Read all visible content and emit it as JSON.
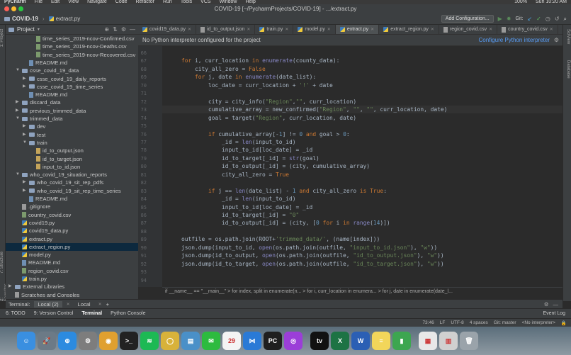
{
  "menubar": {
    "items": [
      "PyCharm",
      "File",
      "Edit",
      "View",
      "Navigate",
      "Code",
      "Refactor",
      "Run",
      "Tools",
      "VCS",
      "Window",
      "Help"
    ],
    "clock": "Sun 10:20 AM",
    "battery": "100%"
  },
  "window": {
    "title": "COVID-19 [~/PycharmProjects/COVID-19] - .../extract.py"
  },
  "navbar": {
    "project": "COVID-19",
    "file": "extract.py",
    "config_button": "Add Configuration...",
    "git_label": "Git:"
  },
  "project_panel": {
    "title": "Project",
    "tree": [
      {
        "label": "time_series_2019-ncov-Confirmed.csv",
        "indent": 3,
        "type": "csv",
        "arrow": ""
      },
      {
        "label": "time_series_2019-ncov-Deaths.csv",
        "indent": 3,
        "type": "csv",
        "arrow": ""
      },
      {
        "label": "time_series_2019-ncov-Recovered.csv",
        "indent": 3,
        "type": "csv",
        "arrow": ""
      },
      {
        "label": "README.md",
        "indent": 2,
        "type": "md",
        "arrow": ""
      },
      {
        "label": "csse_covid_19_data",
        "indent": 1,
        "type": "folder",
        "arrow": "▼"
      },
      {
        "label": "csse_covid_19_daily_reports",
        "indent": 2,
        "type": "folder",
        "arrow": "▶"
      },
      {
        "label": "csse_covid_19_time_series",
        "indent": 2,
        "type": "folder",
        "arrow": "▶"
      },
      {
        "label": "README.md",
        "indent": 2,
        "type": "md",
        "arrow": ""
      },
      {
        "label": "discard_data",
        "indent": 1,
        "type": "folder",
        "arrow": "▶"
      },
      {
        "label": "previous_trimmed_data",
        "indent": 1,
        "type": "folder",
        "arrow": "▶"
      },
      {
        "label": "trimmed_data",
        "indent": 1,
        "type": "folder",
        "arrow": "▼"
      },
      {
        "label": "dev",
        "indent": 2,
        "type": "folder",
        "arrow": "▶"
      },
      {
        "label": "test",
        "indent": 2,
        "type": "folder",
        "arrow": "▶"
      },
      {
        "label": "train",
        "indent": 2,
        "type": "folder",
        "arrow": "▼"
      },
      {
        "label": "id_to_output.json",
        "indent": 3,
        "type": "json",
        "arrow": ""
      },
      {
        "label": "id_to_target.json",
        "indent": 3,
        "type": "json",
        "arrow": ""
      },
      {
        "label": "input_to_id.json",
        "indent": 3,
        "type": "json",
        "arrow": ""
      },
      {
        "label": "who_covid_19_situation_reports",
        "indent": 1,
        "type": "folder",
        "arrow": "▼"
      },
      {
        "label": "who_covid_19_sit_rep_pdfs",
        "indent": 2,
        "type": "folder",
        "arrow": "▶"
      },
      {
        "label": "who_covid_19_sit_rep_time_series",
        "indent": 2,
        "type": "folder",
        "arrow": "▶"
      },
      {
        "label": "README.md",
        "indent": 2,
        "type": "md",
        "arrow": ""
      },
      {
        "label": ".gitignore",
        "indent": 1,
        "type": "file",
        "arrow": ""
      },
      {
        "label": "country_covid.csv",
        "indent": 1,
        "type": "csv",
        "arrow": ""
      },
      {
        "label": "covid19.py",
        "indent": 1,
        "type": "py",
        "arrow": ""
      },
      {
        "label": "covid19_data.py",
        "indent": 1,
        "type": "py",
        "arrow": ""
      },
      {
        "label": "extract.py",
        "indent": 1,
        "type": "py",
        "arrow": ""
      },
      {
        "label": "extract_region.py",
        "indent": 1,
        "type": "py",
        "arrow": "",
        "selected": true
      },
      {
        "label": "model.py",
        "indent": 1,
        "type": "py",
        "arrow": ""
      },
      {
        "label": "README.md",
        "indent": 1,
        "type": "md",
        "arrow": ""
      },
      {
        "label": "region_covid.csv",
        "indent": 1,
        "type": "csv",
        "arrow": ""
      },
      {
        "label": "train.py",
        "indent": 1,
        "type": "py",
        "arrow": ""
      },
      {
        "label": "External Libraries",
        "indent": 0,
        "type": "lib",
        "arrow": "▶"
      },
      {
        "label": "Scratches and Consoles",
        "indent": 0,
        "type": "scratch",
        "arrow": ""
      }
    ]
  },
  "tabs": [
    {
      "label": "covid19_data.py",
      "active": false
    },
    {
      "label": "id_to_output.json",
      "active": false
    },
    {
      "label": "train.py",
      "active": false
    },
    {
      "label": "model.py",
      "active": false
    },
    {
      "label": "extract.py",
      "active": true
    },
    {
      "label": "extract_region.py",
      "active": false
    },
    {
      "label": "region_covid.csv",
      "active": false
    },
    {
      "label": "country_covid.csv",
      "active": false
    }
  ],
  "banner": {
    "message": "No Python interpreter configured for the project",
    "link": "Configure Python interpreter"
  },
  "editor": {
    "line_numbers": [
      "66",
      "67",
      "68",
      "69",
      "70",
      "71",
      "72",
      "73",
      "74",
      "75",
      "76",
      "77",
      "78",
      "79",
      "80",
      "81",
      "82",
      "83",
      "84",
      "85",
      "86",
      "87",
      "88",
      "89",
      "90",
      "91",
      "92",
      "93",
      "94"
    ],
    "lines": [
      "",
      "    for i, curr_location in enumerate(county_data):",
      "        city_all_zero = False",
      "        for j, date in enumerate(date_list):",
      "            loc_date = curr_location + '!' + date",
      "",
      "            city = city_info(\"Region\",\"\", curr_location)",
      "            cumulative_array = new_confirmed(\"Region\", \"\", \"\", curr_location, date)",
      "            goal = target(\"Region\", curr_location, date)",
      "",
      "            if cumulative_array[-1] != 0 and goal > 0:",
      "                _id = len(input_to_id)",
      "                input_to_id[loc_date] = _id",
      "                id_to_target[_id] = str(goal)",
      "                id_to_output[_id] = (city, cumulative_array)",
      "                city_all_zero = True",
      "",
      "            if j == len(date_list) - 1 and city_all_zero is True:",
      "                _id = len(input_to_id)",
      "                input_to_id[loc_date] = _id",
      "                id_to_target[_id] = \"0\"",
      "                id_to_output[_id] = (city, [0 for i in range(14)])",
      "",
      "    outfile = os.path.join(ROOT+'trimmed_data/', (name[index]))",
      "    json.dump(input_to_id, open(os.path.join(outfile, \"input_to_id.json\"), \"w\"))",
      "    json.dump(id_to_output, open(os.path.join(outfile, \"id_to_output.json\"), \"w\"))",
      "    json.dump(id_to_target, open(os.path.join(outfile, \"id_to_target.json\"), \"w\"))",
      "",
      ""
    ],
    "highlighted_line_index": 7,
    "breadcrumbs": "if __name__ == \"__main__\"   >   for index, split in enumerate(n...   >   for i, curr_location in enumera...   >   for j, date in enumerate(date_l..."
  },
  "terminal": {
    "label": "Terminal:",
    "tabs": [
      "Local (2)",
      "Local"
    ],
    "add": "+"
  },
  "toolwindows": {
    "items": [
      "6: TODO",
      "9: Version Control",
      "Terminal",
      "Python Console"
    ],
    "active_index": 2,
    "event_log": "Event Log"
  },
  "statusbar": {
    "position": "73:46",
    "line_sep": "LF",
    "encoding": "UTF-8",
    "indent": "4 spaces",
    "git": "Git: master",
    "interpreter": "<No interpreter>"
  },
  "dock": {
    "apps": [
      {
        "name": "finder-icon",
        "color": "#3a8fe0",
        "glyph": "☺"
      },
      {
        "name": "launchpad-icon",
        "color": "#6c7a86",
        "glyph": "🚀"
      },
      {
        "name": "safari-icon",
        "color": "#2c8be0",
        "glyph": "⊕"
      },
      {
        "name": "system-preferences-icon",
        "color": "#7d7d7d",
        "glyph": "⚙"
      },
      {
        "name": "chrome-icon",
        "color": "#e0a030",
        "glyph": "◉"
      },
      {
        "name": "terminal-icon",
        "color": "#222222",
        "glyph": ">_"
      },
      {
        "name": "spotify-icon",
        "color": "#1db954",
        "glyph": "≋"
      },
      {
        "name": "circle-app-icon",
        "color": "#d8b23a",
        "glyph": "◯"
      },
      {
        "name": "preview-icon",
        "color": "#4a90c8",
        "glyph": "▤"
      },
      {
        "name": "wechat-icon",
        "color": "#2dbb3f",
        "glyph": "✉"
      },
      {
        "name": "calendar-icon",
        "color": "#f4f4f4",
        "glyph": "29"
      },
      {
        "name": "vscode-icon",
        "color": "#2a7ad6",
        "glyph": "⋈"
      },
      {
        "name": "pycharm-icon",
        "color": "#1f1f1f",
        "glyph": "PC"
      },
      {
        "name": "podcasts-icon",
        "color": "#9b3ed8",
        "glyph": "◎"
      },
      {
        "name": "apple-tv-icon",
        "color": "#111111",
        "glyph": "tv"
      },
      {
        "name": "excel-icon",
        "color": "#1d7344",
        "glyph": "X"
      },
      {
        "name": "word-icon",
        "color": "#2b5fb4",
        "glyph": "W"
      },
      {
        "name": "notes-icon",
        "color": "#f2d65a",
        "glyph": "≡"
      },
      {
        "name": "numbers-icon",
        "color": "#3da650",
        "glyph": "▮"
      },
      {
        "name": "document-icon",
        "color": "#e8e8e8",
        "glyph": "▦"
      },
      {
        "name": "screenshot-icon",
        "color": "#d0d0d0",
        "glyph": "▥"
      },
      {
        "name": "trash-icon",
        "color": "#9aa3aa",
        "glyph": "🗑"
      }
    ]
  }
}
